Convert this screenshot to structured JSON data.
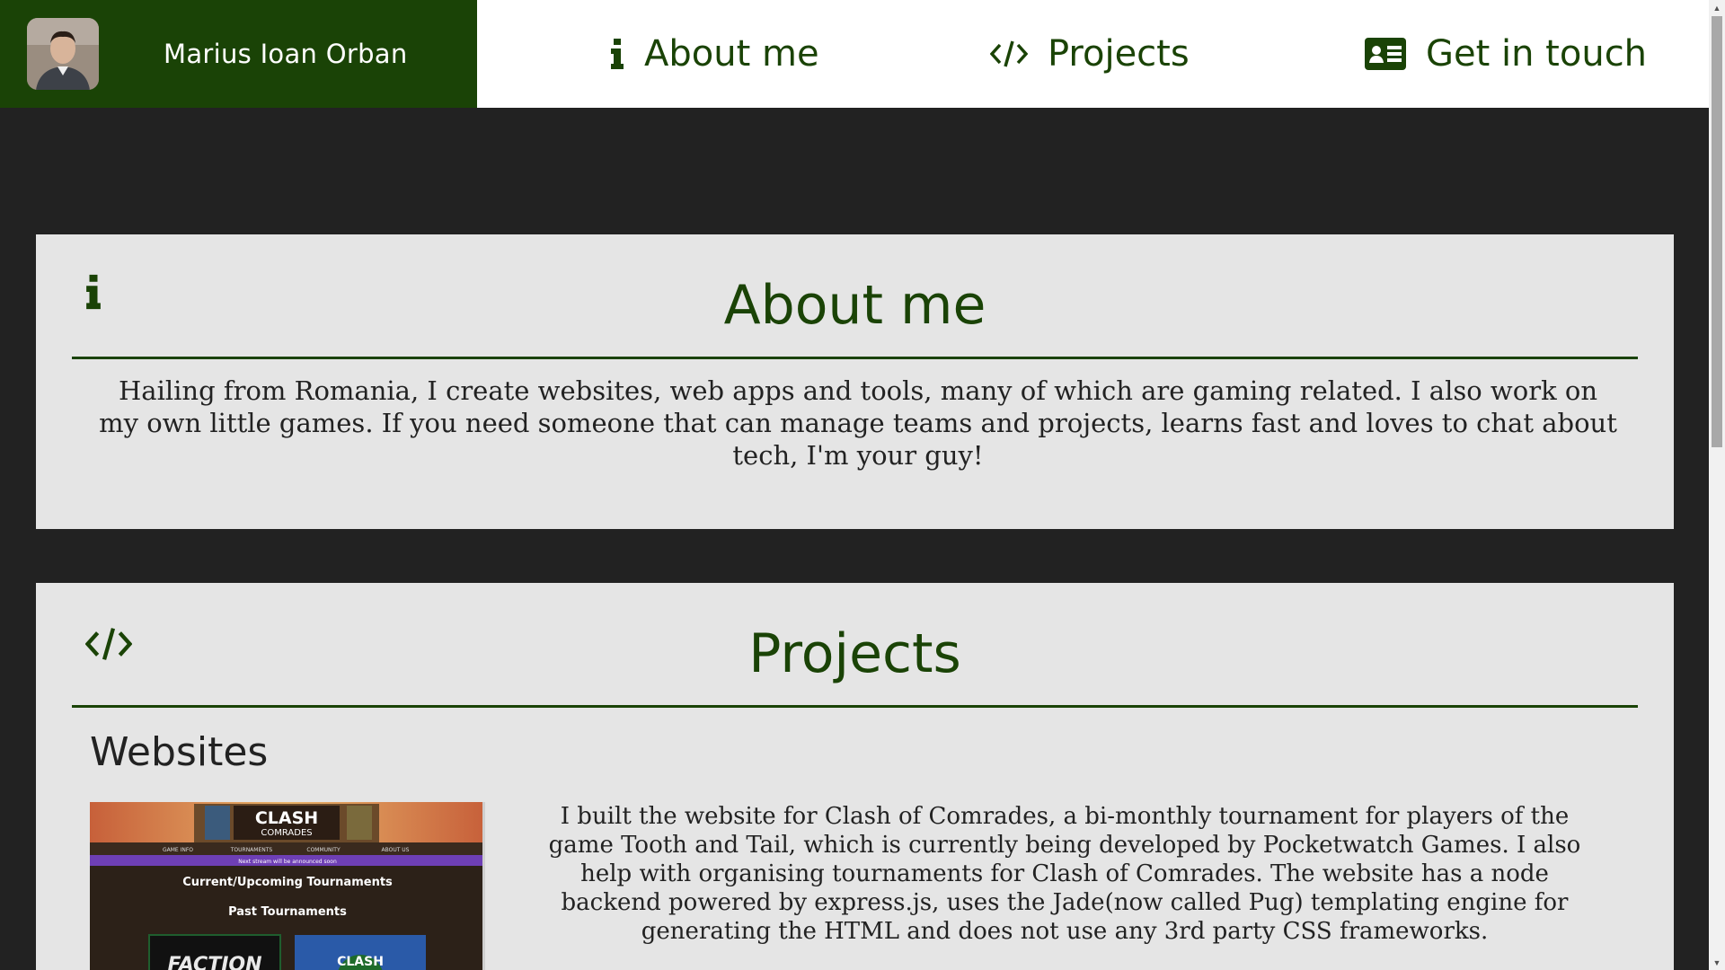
{
  "header": {
    "brand_name": "Marius Ioan Orban",
    "nav": [
      {
        "label": "About me",
        "icon": "info-icon"
      },
      {
        "label": "Projects",
        "icon": "code-icon"
      },
      {
        "label": "Get in touch",
        "icon": "contact-card-icon"
      }
    ]
  },
  "about": {
    "title": "About me",
    "icon": "info-icon",
    "text": "Hailing from Romania, I create websites, web apps and tools, many of which are gaming related. I also work on my own little games. If you need someone that can manage teams and projects, learns fast and loves to chat about tech, I'm your guy!"
  },
  "projects": {
    "title": "Projects",
    "icon": "code-icon",
    "subheading": "Websites",
    "items": [
      {
        "thumbnail": {
          "logo_line1": "CLASH",
          "logo_line2": "COMRADES",
          "nav": [
            "GAME INFO",
            "TOURNAMENTS",
            "COMMUNITY",
            "ABOUT US"
          ],
          "banner": "Next stream will be announced soon",
          "heading1": "Current/Upcoming Tournaments",
          "heading2": "Past Tournaments",
          "card1": "FACTION",
          "card2": "CLASH"
        },
        "text": "I built the website for Clash of Comrades, a bi-monthly tournament for players of the game Tooth and Tail, which is currently being developed by Pocketwatch Games. I also help with organising tournaments for Clash of Comrades. The website has a node backend powered by express.js, uses the Jade(now called Pug) templating engine for generating the HTML and does not use any 3rd party CSS frameworks."
      }
    ]
  },
  "colors": {
    "primary": "#1a4306",
    "page_background": "#222222",
    "card_background": "#e5e5e5"
  }
}
